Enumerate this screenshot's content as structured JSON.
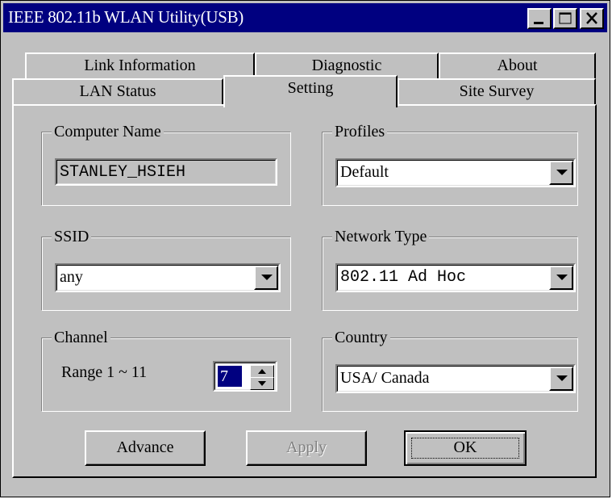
{
  "window": {
    "title": "IEEE 802.11b WLAN Utility(USB)",
    "controls": {
      "minimize": "minimize-icon",
      "maximize": "maximize-icon",
      "close": "close-icon"
    }
  },
  "tabs": {
    "row1": [
      "Link Information",
      "Diagnostic",
      "About"
    ],
    "row2": [
      "LAN Status",
      "Setting",
      "Site Survey"
    ],
    "active": "Setting"
  },
  "computer_name": {
    "label": "Computer Name",
    "value": "STANLEY_HSIEH"
  },
  "profiles": {
    "label": "Profiles",
    "selected": "Default"
  },
  "ssid": {
    "label": "SSID",
    "selected": "any"
  },
  "network_type": {
    "label": "Network Type",
    "selected": "802.11 Ad Hoc"
  },
  "channel": {
    "label": "Channel",
    "range_text": "Range 1 ~ 11",
    "value": "7"
  },
  "country": {
    "label": "Country",
    "selected": "USA/ Canada"
  },
  "buttons": {
    "advance": "Advance",
    "apply": "Apply",
    "ok": "OK"
  },
  "colors": {
    "face": "#c0c0c0",
    "titlebar": "#000080",
    "selection": "#000080"
  }
}
